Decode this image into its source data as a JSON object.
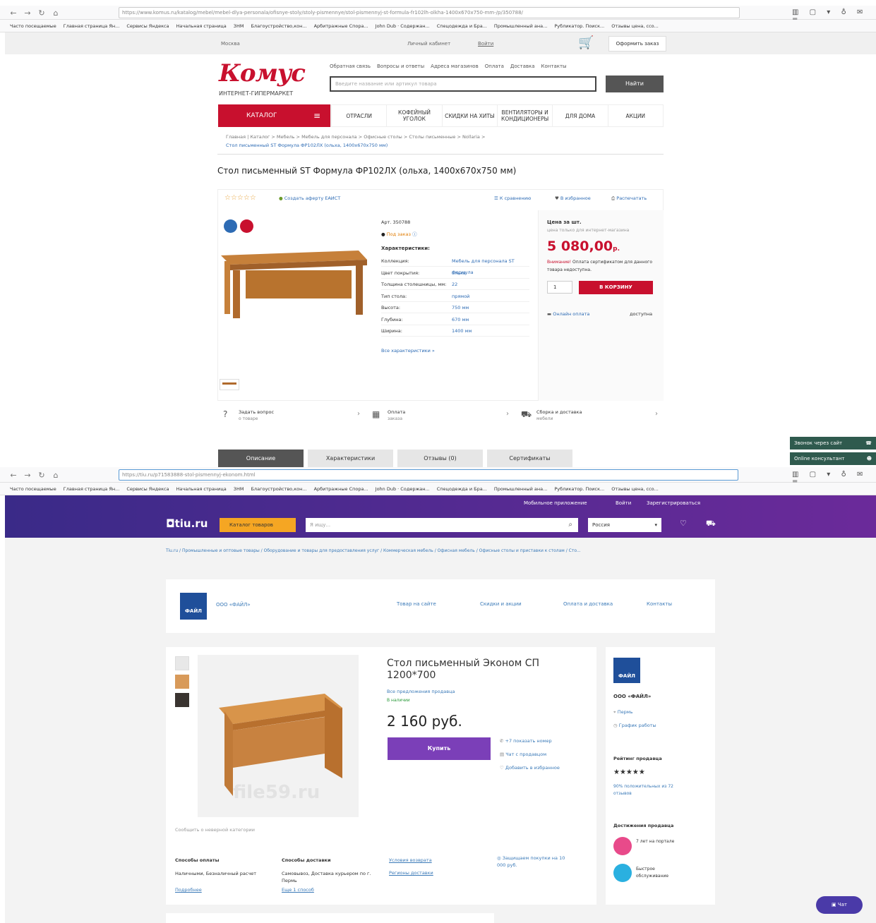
{
  "browser1": {
    "url": "https://www.komus.ru/katalog/mebel/mebel-dlya-personala/ofisnye-stoly/stoly-pismennye/stol-pismennyj-st-formula-fr102lh-olkha-1400x670x750-mm-/p/350788/",
    "bookmarks": [
      "Часто посещаемые",
      "Главная страница Ян...",
      "Сервисы Яндекса",
      "Начальная страница",
      "ЗНМ",
      "Благоустройство,кон...",
      "Арбитражные Спора...",
      "John Dub · Содержан...",
      "Спецодежда и Бра...",
      "Промышленный ана...",
      "Рубликатор. Поиск...",
      "Отзывы цена, ссо..."
    ]
  },
  "komus": {
    "city": "Москва",
    "cabinet": "Личный кабинет",
    "login": "Войти",
    "checkout": "Оформить заказ",
    "logo": "Комус",
    "logo_sub": "ИНТЕРНЕТ-ГИПЕРМАРКЕТ",
    "toplinks": [
      "Обратная связь",
      "Вопросы и ответы",
      "Адреса магазинов",
      "Оплата",
      "Доставка",
      "Контакты"
    ],
    "search_placeholder": "Введите название или артикул товара",
    "search_btn": "Найти",
    "catalog": "КАТАЛОГ",
    "menu": [
      "ОТРАСЛИ",
      "КОФЕЙНЫЙ УГОЛОК",
      "СКИДКИ НА ХИТЫ",
      "ВЕНТИЛЯТОРЫ И КОНДИЦИОНЕРЫ",
      "ДЛЯ ДОМА",
      "АКЦИИ"
    ],
    "breadcrumb1": "Главная | Каталог > Мебель > Мебель для персонала > Офисные столы > Столы письменные > Nollaria >",
    "breadcrumb2": "Стол письменный ST Формула ФР102ЛХ (ольха, 1400x670x750 мм)",
    "title": "Стол письменный ST Формула ФР102ЛХ (ольха, 1400x670x750 мм)",
    "stars": "☆☆☆☆☆",
    "eco": "Создать аферту ЕАИСТ",
    "compare": "К сравнению",
    "fav": "В избранное",
    "print": "Распечатать",
    "art": "Арт. 350788",
    "order": "Под заказ",
    "char_title": "Характеристики:",
    "chars": [
      {
        "k": "Коллекция:",
        "v": "Мебель для персонала ST Формула"
      },
      {
        "k": "Цвет покрытия:",
        "v": "ольха"
      },
      {
        "k": "Толщина столешницы, мм:",
        "v": "22"
      },
      {
        "k": "Тип стола:",
        "v": "прямой"
      },
      {
        "k": "Высота:",
        "v": "750 мм"
      },
      {
        "k": "Глубина:",
        "v": "670 мм"
      },
      {
        "k": "Ширина:",
        "v": "1400 мм"
      }
    ],
    "all_chars": "Все характеристики »",
    "price_label": "Цена за шт.",
    "price_note": "цена только для интернет-магазина",
    "price": "5 080,00",
    "currency": "р.",
    "warn_red": "Внимание!",
    "warn": "Оплата сертификатом для данного товара недоступна.",
    "qty": "1",
    "cart": "В КОРЗИНУ",
    "online_pay": "Онлайн оплата",
    "available": "доступна",
    "info": [
      {
        "t": "Задать вопрос",
        "s": "о товаре"
      },
      {
        "t": "Оплата",
        "s": "заказа"
      },
      {
        "t": "Сборка и доставка",
        "s": "мебели"
      }
    ],
    "tabs": [
      "Описание",
      "Характеристики",
      "Отзывы (0)",
      "Сертификаты"
    ],
    "callback": "Звонок через сайт",
    "consult": "Online консультант"
  },
  "browser2": {
    "url": "https://tiu.ru/p71583888-stol-pismennyj-ekonom.html"
  },
  "tiu": {
    "mobile": "Мобильное приложение",
    "login": "Войти",
    "register": "Зарегистрироваться",
    "logo": "tiu.ru",
    "catalog": "Каталог товаров",
    "search_placeholder": "Я ищу...",
    "region": "Россия",
    "breadcrumb": "Tiu.ru / Промышленные и оптовые товары / Оборудование и товары для предоставления услуг / Коммерческая мебель / Офисная мебель / Офисные столы и приставки к столам / Сто...",
    "seller": "ООО «ФАЙЛ»",
    "nav": [
      "Товар на сайте",
      "Скидки и акции",
      "Оплата и доставка",
      "Контакты"
    ],
    "title": "Стол письменный Эконом СП 1200*700",
    "all_offers": "Все предложения продавца",
    "in_stock": "В наличии",
    "price": "2 160 руб.",
    "buy": "Купить",
    "phone": "+7 показать номер",
    "chat_seller": "Чат с продавцом",
    "add_fav": "Добавить в избранное",
    "watermark": "file59.ru",
    "report": "Сообщить о неверной категории",
    "pay_title": "Способы оплаты",
    "pay_text": "Наличными, Безналичный расчет",
    "more": "Подробнее",
    "deliv_title": "Способы доставки",
    "deliv_text": "Самовывоз, Доставка курьером по г. Пермь",
    "all_methods": "Еще 1 способ",
    "terms": "Условия возврата",
    "regions": "Регионы доставки",
    "protect": "Защищаем покупки на 10 000 руб.",
    "seller_name": "ООО «ФАЙЛ»",
    "city": "Пермь",
    "schedule": "График работы",
    "rating_title": "Рейтинг продавца",
    "rating_stars": "★★★★★",
    "rating_text": "90% положительных из 72 отзывов",
    "achieve_title": "Достижения продавца",
    "ach1": "7 лет на портале",
    "ach2": "Быстрое обслуживание",
    "chat": "Чат",
    "logo_text": "ФАЙЛ"
  }
}
